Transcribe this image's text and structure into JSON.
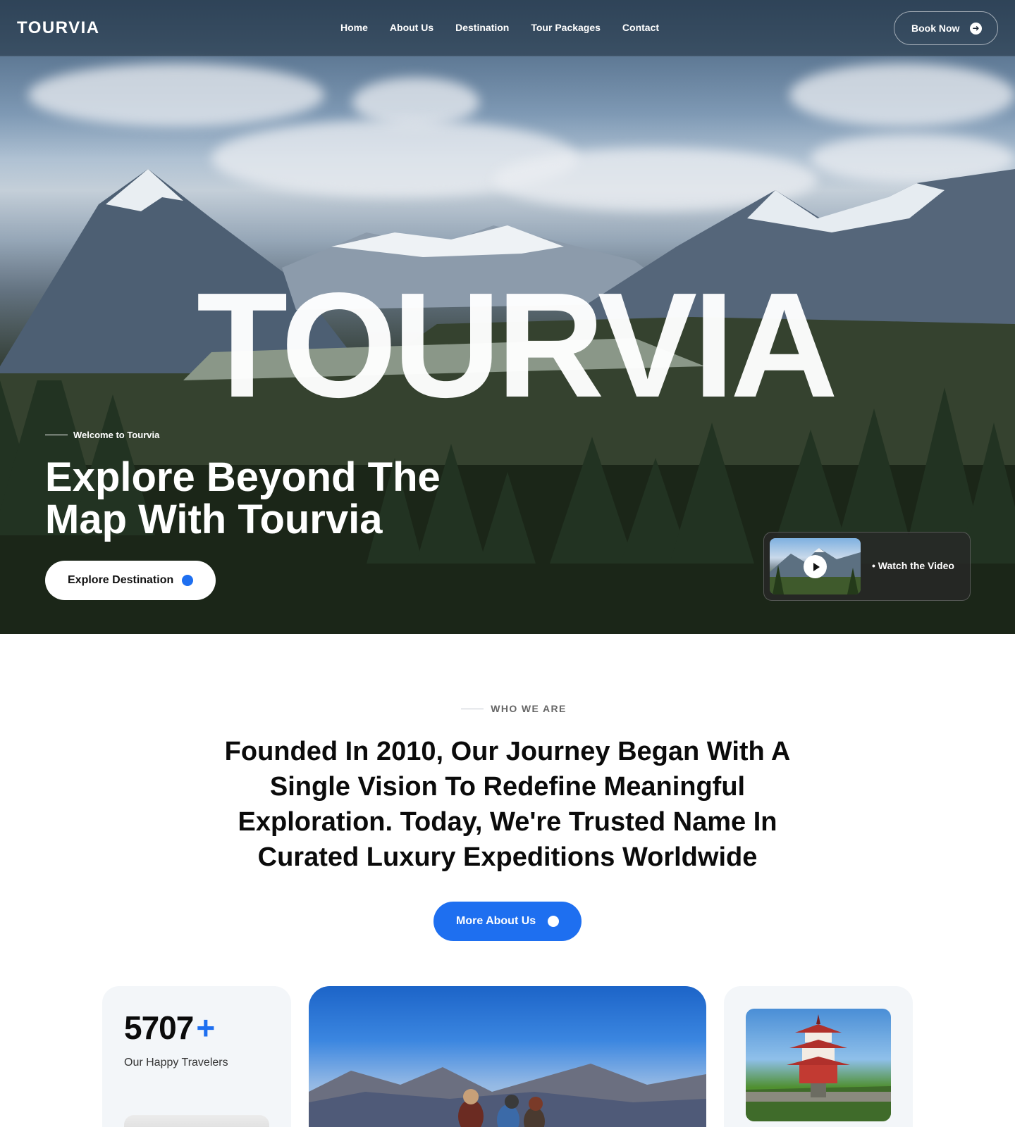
{
  "brand": {
    "logo": "TOURVIA"
  },
  "nav": {
    "links": [
      "Home",
      "About Us",
      "Destination",
      "Tour Packages",
      "Contact"
    ],
    "book_label": "Book Now"
  },
  "hero": {
    "big_word": "TOURVIA",
    "welcome": "Welcome to Tourvia",
    "title": "Explore Beyond The Map With Tourvia",
    "explore_label": "Explore Destination",
    "video_label": "• Watch the Video"
  },
  "about": {
    "tag": "WHO WE ARE",
    "heading": "Founded In 2010, Our Journey Began With A Single Vision To Redefine Meaningful Exploration. Today, We're Trusted Name In Curated Luxury Expeditions Worldwide",
    "button_label": "More About Us"
  },
  "stats": {
    "number": "5707",
    "plus": "+",
    "label": "Our Happy Travelers"
  },
  "colors": {
    "accent": "#1e6ff0",
    "card_bg": "#f3f6f9"
  },
  "icons": [
    "arrow-right-icon",
    "play-icon",
    "accent-dot-icon"
  ]
}
